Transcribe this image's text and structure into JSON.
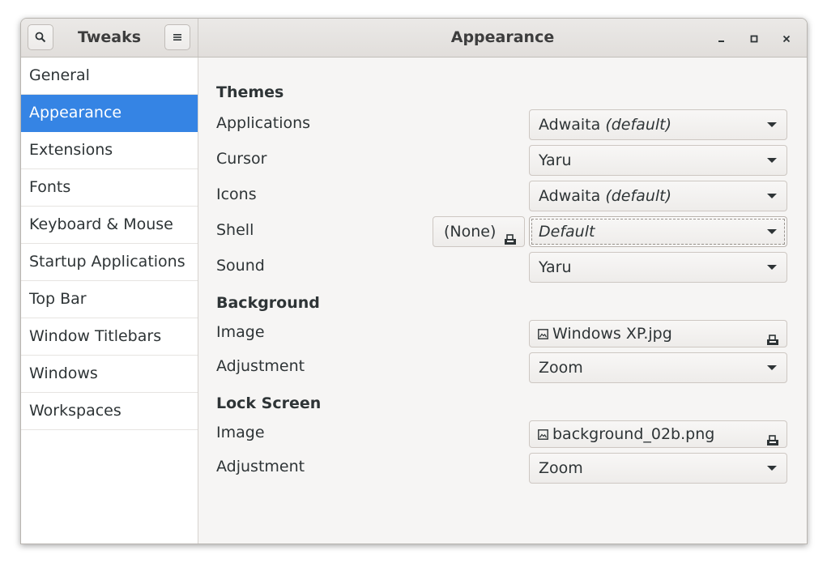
{
  "window": {
    "sidebar_title": "Tweaks",
    "main_title": "Appearance",
    "search_icon": "search-icon",
    "menu_icon": "hamburger-menu-icon",
    "controls": [
      "minimize-icon",
      "maximize-icon",
      "close-icon"
    ]
  },
  "sidebar": {
    "selected": "Appearance",
    "items": [
      {
        "label": "General"
      },
      {
        "label": "Appearance"
      },
      {
        "label": "Extensions"
      },
      {
        "label": "Fonts"
      },
      {
        "label": "Keyboard & Mouse"
      },
      {
        "label": "Startup Applications"
      },
      {
        "label": "Top Bar"
      },
      {
        "label": "Window Titlebars"
      },
      {
        "label": "Windows"
      },
      {
        "label": "Workspaces"
      }
    ]
  },
  "themes": {
    "heading": "Themes",
    "applications": {
      "label": "Applications",
      "value": "Adwaita",
      "suffix": "(default)"
    },
    "cursor": {
      "label": "Cursor",
      "value": "Yaru"
    },
    "icons": {
      "label": "Icons",
      "value": "Adwaita",
      "suffix": "(default)"
    },
    "shell": {
      "label": "Shell",
      "file_button": "(None)",
      "value": "Default"
    },
    "sound": {
      "label": "Sound",
      "value": "Yaru"
    }
  },
  "background": {
    "heading": "Background",
    "image": {
      "label": "Image",
      "file": "Windows XP.jpg"
    },
    "adjustment": {
      "label": "Adjustment",
      "value": "Zoom"
    }
  },
  "lock_screen": {
    "heading": "Lock Screen",
    "image": {
      "label": "Image",
      "file": "background_02b.png"
    },
    "adjustment": {
      "label": "Adjustment",
      "value": "Zoom"
    }
  },
  "colors": {
    "accent": "#3584e4",
    "window_bg": "#f6f5f4",
    "sidebar_bg": "#ffffff",
    "text": "#2e3436"
  }
}
